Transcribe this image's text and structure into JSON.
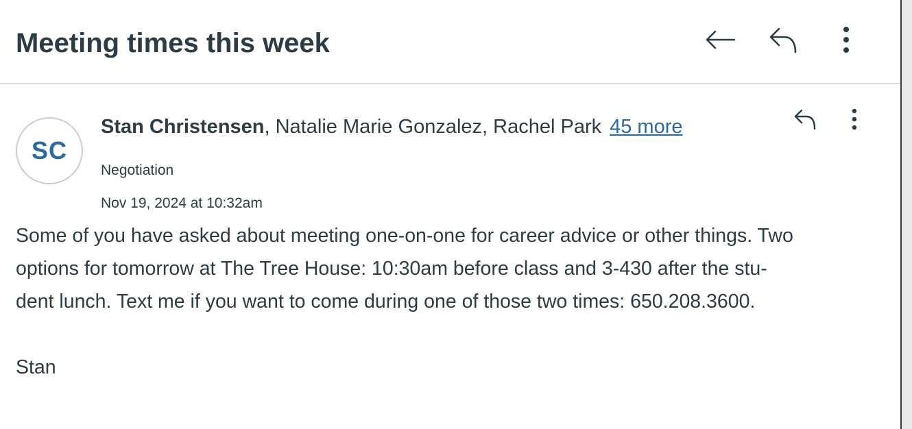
{
  "header": {
    "title": "Meeting times this week",
    "back_icon": "arrow-left-icon",
    "reply_icon": "reply-icon",
    "more_icon": "kebab-menu-icon"
  },
  "message": {
    "avatar_initials": "SC",
    "sender": "Stan Christensen",
    "other_recipients": ", Natalie Marie Gonzalez, Rachel Park",
    "more_link": "45 more",
    "course": "Negotiation",
    "timestamp": "Nov 19, 2024 at 10:32am",
    "body_lines": [
      "Some of you have asked about meeting one-on-one for career advice or other things. Two",
      "options for tomorrow at The Tree House: 10:30am before class and 3-430 after the stu-",
      "dent lunch. Text me if you want to come during one of those two times: 650.208.3600."
    ],
    "signature": "Stan",
    "reply_icon": "reply-icon",
    "more_icon": "kebab-menu-icon"
  },
  "colors": {
    "text": "#2d3b45",
    "link": "#2b6aa0",
    "divider": "#c7cdd1"
  }
}
